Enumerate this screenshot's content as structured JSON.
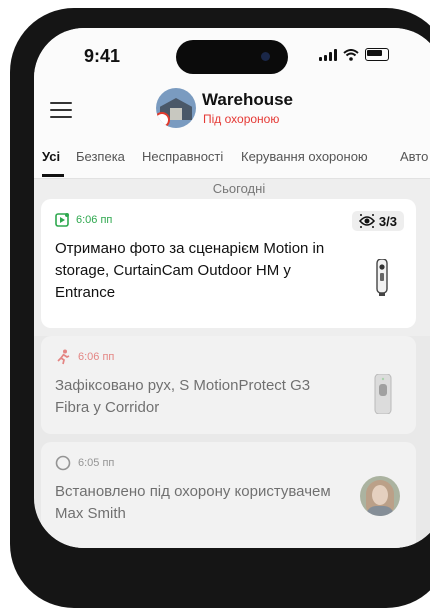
{
  "status_bar": {
    "time": "9:41"
  },
  "header": {
    "site_name": "Warehouse",
    "site_status": "Під охороною"
  },
  "tabs": [
    {
      "label": "Усі",
      "active": true
    },
    {
      "label": "Безпека",
      "active": false
    },
    {
      "label": "Несправності",
      "active": false
    },
    {
      "label": "Керування охороною",
      "active": false
    },
    {
      "label": "Авто",
      "active": false
    }
  ],
  "date_header": "Сьогодні",
  "events": [
    {
      "time": "6:06 пп",
      "message": "Отримано фото за сценарієм Motion in storage, CurtainCam Outdoor HM у Entrance",
      "badge": "3/3",
      "icon": "camera-play-icon",
      "color": "#2fa84f",
      "device": "curtain-cam-icon"
    },
    {
      "time": "6:06 пп",
      "message": "Зафіксовано рух, S MotionProtect G3 Fibra у Corridor",
      "icon": "running-person-icon",
      "color": "#e53935",
      "device": "motion-detector-icon"
    },
    {
      "time": "6:05 пп",
      "message": "Встановлено під охорону користувачем Max Smith",
      "icon": "circle-icon",
      "color": "#555555",
      "device": "user-avatar"
    }
  ]
}
